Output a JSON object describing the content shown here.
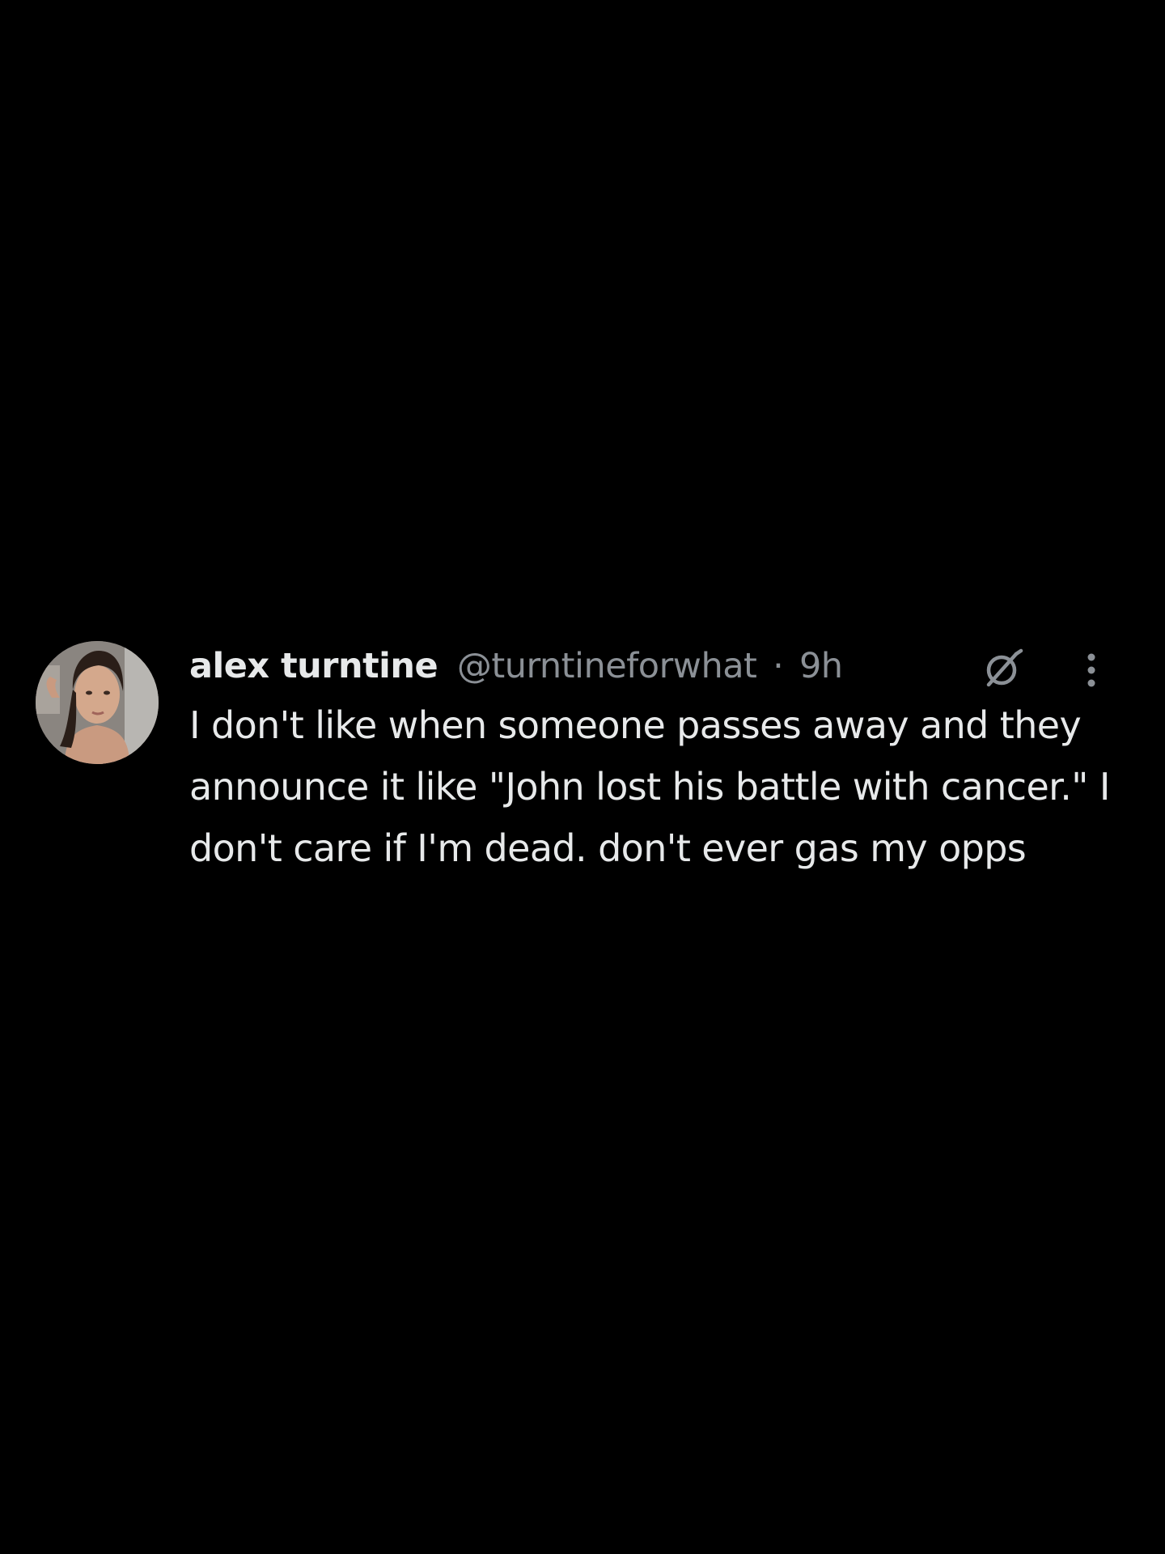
{
  "tweet": {
    "display_name": "alex turntine",
    "handle": "@turntineforwhat",
    "separator": "·",
    "time": "9h",
    "text": "I don't like when someone passes away and they announce it like \"John lost his battle with cancer.\" I don't care if I'm dead. don't ever gas my opps",
    "icons": {
      "avatar": "profile-photo",
      "grok": "grok-icon",
      "more": "more-options-icon"
    }
  },
  "colors": {
    "background": "#000000",
    "primary_text": "#e7e9ea",
    "secondary_text": "#8b9096"
  }
}
